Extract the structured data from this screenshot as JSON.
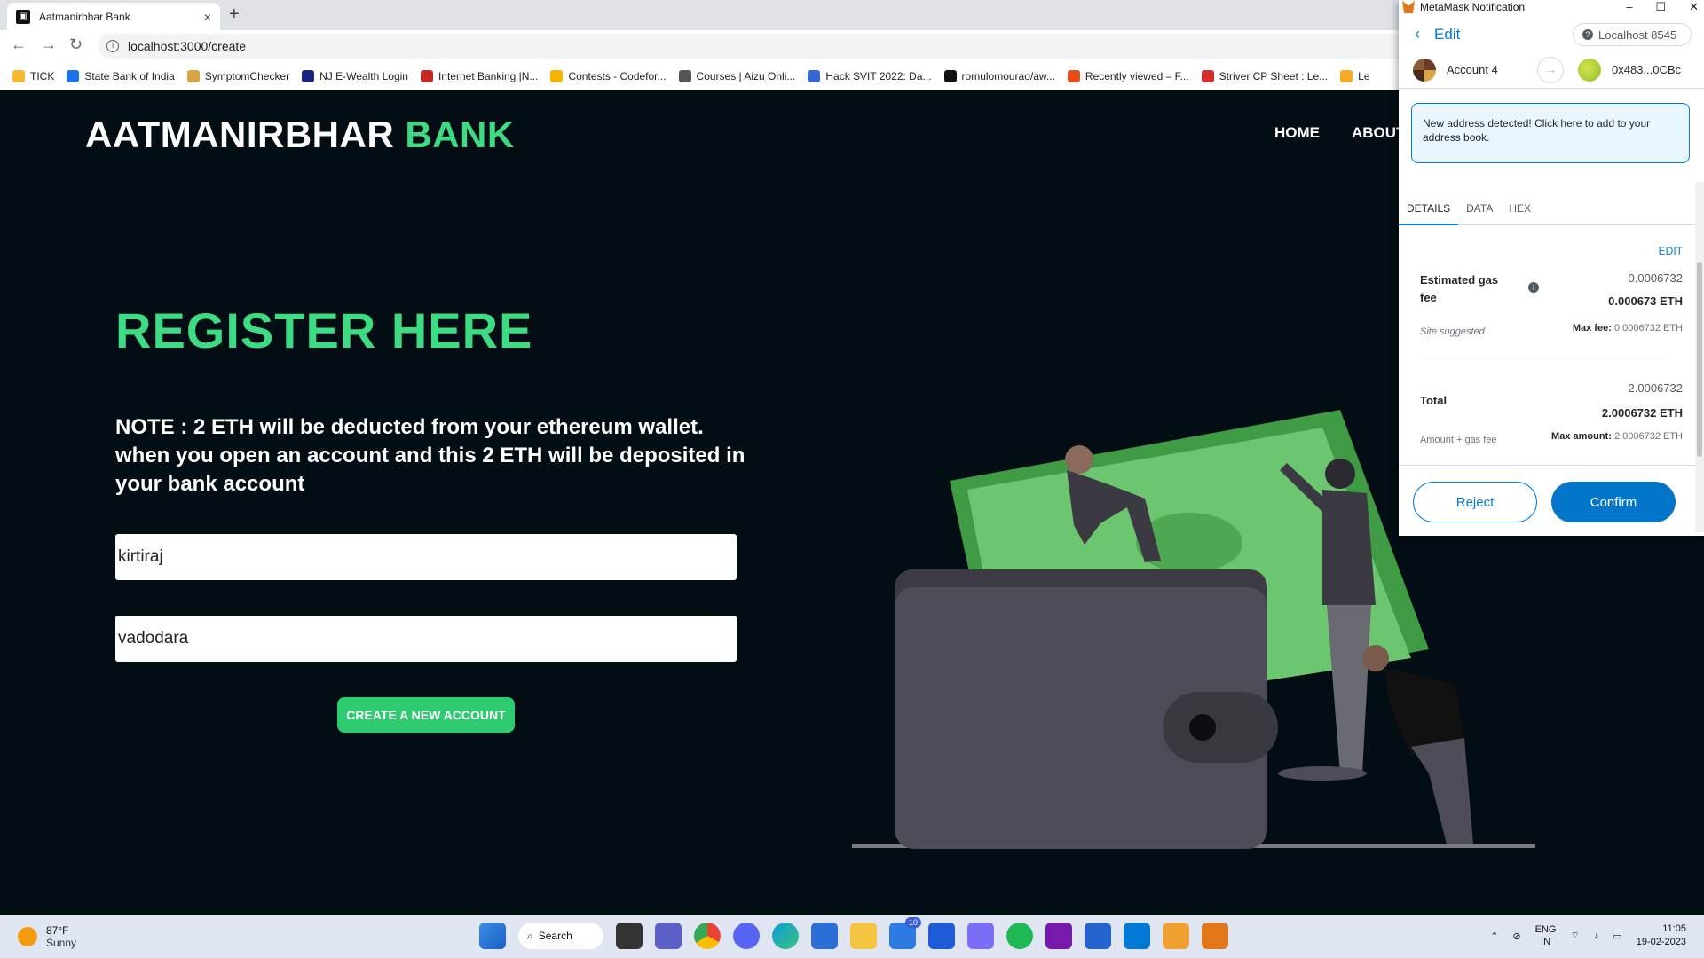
{
  "browser": {
    "tab_title": "Aatmanirbhar Bank",
    "tab_close": "×",
    "new_tab": "+",
    "url": "localhost:3000/create",
    "bookmarks": [
      {
        "label": "TICK",
        "color": "#f7b733"
      },
      {
        "label": "State Bank of India",
        "color": "#1a73e8"
      },
      {
        "label": "SymptomChecker",
        "color": "#d9a441"
      },
      {
        "label": "NJ E-Wealth Login",
        "color": "#1a237e"
      },
      {
        "label": "Internet Banking |N...",
        "color": "#c62828"
      },
      {
        "label": "Contests - Codefor...",
        "color": "#f4b400"
      },
      {
        "label": "Courses | Aizu Onli...",
        "color": "#555555"
      },
      {
        "label": "Hack SVIT 2022: Da...",
        "color": "#3367d6"
      },
      {
        "label": "romulomourao/aw...",
        "color": "#111111"
      },
      {
        "label": "Recently viewed – F...",
        "color": "#e64a19"
      },
      {
        "label": "Striver CP Sheet : Le...",
        "color": "#d32f2f"
      },
      {
        "label": "Le",
        "color": "#f9a825"
      }
    ]
  },
  "page": {
    "brand_white": "AATMANIRBHAR",
    "brand_green": "BANK",
    "nav": [
      "HOME",
      "ABOUT"
    ],
    "heading": "REGISTER HERE",
    "note": "NOTE : 2 ETH will be deducted from your ethereum wallet. when you open an account and this 2 ETH will be deposited in your bank account",
    "name_value": "kirtiraj",
    "city_value": "vadodara",
    "create_button": "CREATE A NEW ACCOUNT"
  },
  "metamask": {
    "window_title": "MetaMask Notification",
    "win_buttons": [
      "–",
      "☐",
      "✕"
    ],
    "back_label": "Edit",
    "network": "Localhost 8545",
    "account_name": "Account 4",
    "to_address": "0x483...0CBc",
    "notice": "New address detected! Click here to add to your address book.",
    "tabs": [
      "DETAILS",
      "DATA",
      "HEX"
    ],
    "edit_link": "EDIT",
    "gas_label": "Estimated gas fee",
    "gas_secondary": "0.0006732",
    "gas_primary": "0.000673 ETH",
    "site_suggested": "Site suggested",
    "max_fee_label": "Max fee:",
    "max_fee_value": "0.0006732 ETH",
    "total_label": "Total",
    "total_secondary": "2.0006732",
    "total_primary": "2.0006732 ETH",
    "amount_gas_label": "Amount + gas fee",
    "max_amount_label": "Max amount:",
    "max_amount_value": "2.0006732 ETH",
    "reject": "Reject",
    "confirm": "Confirm"
  },
  "taskbar": {
    "temp": "87°F",
    "weather": "Sunny",
    "search": "Search",
    "mail_badge": "10",
    "lang1": "ENG",
    "lang2": "IN",
    "time": "11:05",
    "date": "19-02-2023"
  }
}
